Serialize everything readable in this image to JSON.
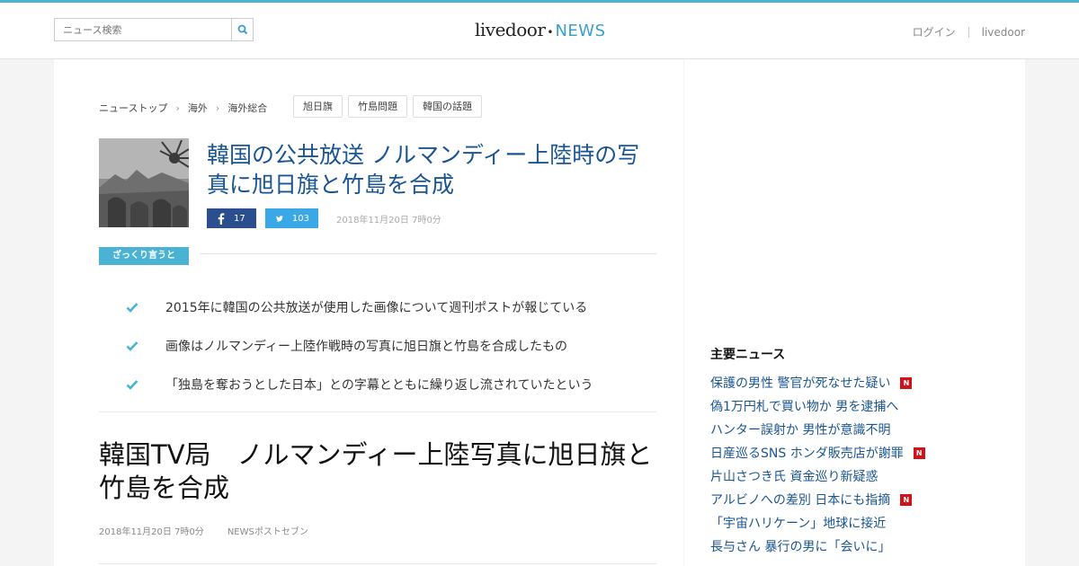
{
  "header": {
    "search_placeholder": "ニュース検索",
    "logo_livedoor": "livedoor",
    "logo_news": "NEWS",
    "nav": [
      "ログイン",
      "livedoor"
    ]
  },
  "breadcrumb": [
    "ニューストップ",
    "海外",
    "海外総合"
  ],
  "tags": [
    "旭日旗",
    "竹島問題",
    "韓国の話題"
  ],
  "article": {
    "title": "韓国の公共放送 ノルマンディー上陸時の写真に旭日旗と竹島を合成",
    "facebook_count": "17",
    "twitter_count": "103",
    "date": "2018年11月20日 7時0分",
    "summary_label": "ざっくり言うと",
    "summary": [
      "2015年に韓国の公共放送が使用した画像について週刊ポストが報じている",
      "画像はノルマンディー上陸作戦時の写真に旭日旗と竹島を合成したもの",
      "「独島を奪おうとした日本」との字幕とともに繰り返し流されていたという"
    ],
    "headline": "韓国TV局　ノルマンディー上陸写真に旭日旗と竹島を合成",
    "meta_date": "2018年11月20日 7時0分",
    "source": "NEWSポストセブン"
  },
  "sidebar": {
    "heading": "主要ニュース",
    "items": [
      {
        "text": "保護の男性 警官が死なせた疑い",
        "badge": "N"
      },
      {
        "text": "偽1万円札で買い物か 男を逮捕へ",
        "badge": ""
      },
      {
        "text": "ハンター誤射か 男性が意識不明",
        "badge": ""
      },
      {
        "text": "日産巡るSNS ホンダ販売店が謝罪",
        "badge": "N"
      },
      {
        "text": "片山さつき氏 資金巡り新疑惑",
        "badge": ""
      },
      {
        "text": "アルビノへの差別 日本にも指摘",
        "badge": "N"
      },
      {
        "text": "「宇宙ハリケーン」地球に接近",
        "badge": ""
      },
      {
        "text": "長与さん 暴行の男に「会いに」",
        "badge": ""
      }
    ]
  },
  "colors": {
    "accent": "#4ab3d3",
    "link": "#1a5593",
    "facebook": "#2b4f8e",
    "twitter": "#3aa8e6",
    "badge": "#d0121b"
  }
}
